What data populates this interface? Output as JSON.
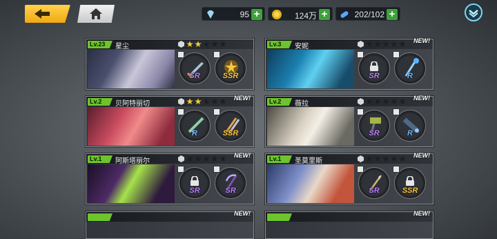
{
  "top": {
    "diamonds": "95",
    "gold": "124万",
    "stamina": "202/102",
    "plus": "+"
  },
  "colors": {
    "accent_yellow": "#f1a913",
    "level_green": "#6dc42c",
    "star_gold": "#f3cf2c",
    "plus_green": "#3ea13a"
  },
  "cards": [
    {
      "level": "Lv.23",
      "name": "星尘",
      "stars": 2,
      "new": "",
      "slots": [
        {
          "rarity": "SR",
          "locked": false,
          "icon": "sword-icon"
        },
        {
          "rarity": "SSR",
          "locked": false,
          "icon": "star-emblem-icon"
        }
      ]
    },
    {
      "level": "Lv.3",
      "name": "安妮",
      "stars": 0,
      "new": "NEW!",
      "slots": [
        {
          "rarity": "SR",
          "locked": true,
          "icon": "lock-icon"
        },
        {
          "rarity": "R",
          "locked": false,
          "icon": "staff-icon"
        }
      ]
    },
    {
      "level": "Lv.2",
      "name": "贝阿特丽切",
      "stars": 2,
      "new": "NEW!",
      "slots": [
        {
          "rarity": "R",
          "locked": false,
          "icon": "rifle-icon"
        },
        {
          "rarity": "SSR",
          "locked": false,
          "icon": "twin-blades-icon"
        }
      ]
    },
    {
      "level": "Lv.2",
      "name": "薇拉",
      "stars": 0,
      "new": "NEW!",
      "slots": [
        {
          "rarity": "SR",
          "locked": false,
          "icon": "hammer-icon"
        },
        {
          "rarity": "R",
          "locked": false,
          "icon": "cannon-icon"
        }
      ]
    },
    {
      "level": "Lv.1",
      "name": "阿斯塔丽尔",
      "stars": 0,
      "new": "NEW!",
      "slots": [
        {
          "rarity": "SR",
          "locked": true,
          "icon": "lock-icon"
        },
        {
          "rarity": "SR",
          "locked": false,
          "icon": "scythe-icon"
        }
      ]
    },
    {
      "level": "Lv.1",
      "name": "圣莫里斯",
      "stars": 0,
      "new": "NEW!",
      "slots": [
        {
          "rarity": "SR",
          "locked": false,
          "icon": "spear-icon"
        },
        {
          "rarity": "SSR",
          "locked": true,
          "icon": "lock-icon"
        }
      ]
    }
  ],
  "partial_row": {
    "left_new": "NEW!",
    "right_new": "NEW!"
  }
}
